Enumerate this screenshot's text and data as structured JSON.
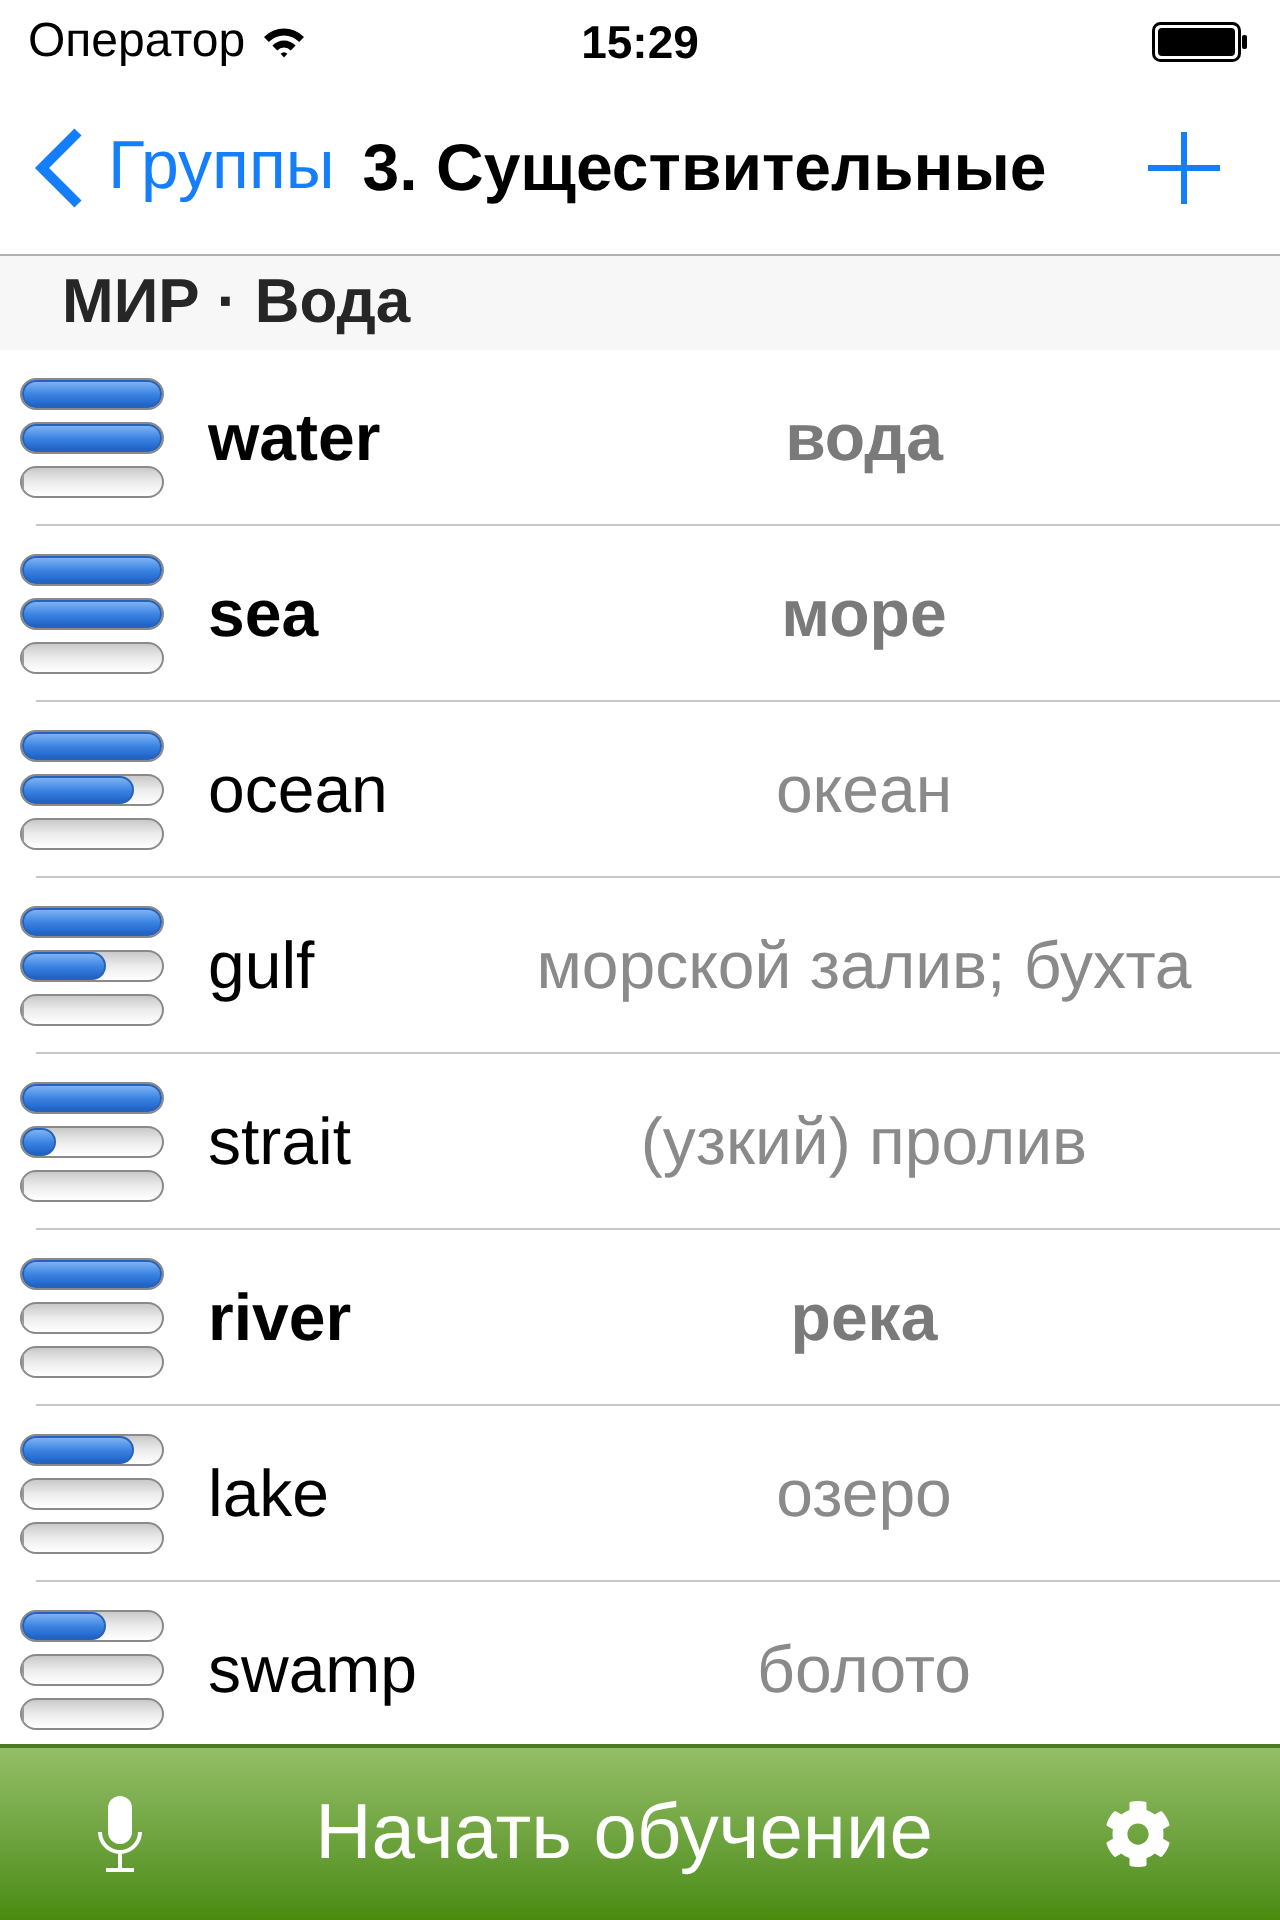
{
  "status_bar": {
    "carrier": "Оператор",
    "time": "15:29"
  },
  "nav": {
    "back": "Группы",
    "title": "3. Существительные"
  },
  "section": {
    "title": "МИР · Вода"
  },
  "rows": [
    {
      "word": "water",
      "translation": "вода",
      "bold": true,
      "bars": [
        {
          "level": 1
        },
        {
          "level": 1
        },
        {
          "level": 0
        }
      ]
    },
    {
      "word": "sea",
      "translation": "море",
      "bold": true,
      "bars": [
        {
          "level": 1
        },
        {
          "level": 1
        },
        {
          "level": 0
        }
      ]
    },
    {
      "word": "ocean",
      "translation": "океан",
      "bold": false,
      "bars": [
        {
          "level": 1
        },
        {
          "level": 0.8
        },
        {
          "level": 0
        }
      ]
    },
    {
      "word": "gulf",
      "translation": "морской залив; бухта",
      "bold": false,
      "bars": [
        {
          "level": 1
        },
        {
          "level": 0.6
        },
        {
          "level": 0
        }
      ]
    },
    {
      "word": "strait",
      "translation": "(узкий) пролив",
      "bold": false,
      "bars": [
        {
          "level": 1
        },
        {
          "level": 0.24
        },
        {
          "level": 0
        }
      ]
    },
    {
      "word": "river",
      "translation": "река",
      "bold": true,
      "bars": [
        {
          "level": 1
        },
        {
          "level": 0
        },
        {
          "level": 0
        }
      ]
    },
    {
      "word": "lake",
      "translation": "озеро",
      "bold": false,
      "bars": [
        {
          "level": 0.8
        },
        {
          "level": 0
        },
        {
          "level": 0
        }
      ]
    },
    {
      "word": "swamp",
      "translation": "болото",
      "bold": false,
      "bars": [
        {
          "level": 0.6
        },
        {
          "level": 0
        },
        {
          "level": 0
        }
      ]
    }
  ],
  "toolbar": {
    "button": "Начать обучение"
  }
}
